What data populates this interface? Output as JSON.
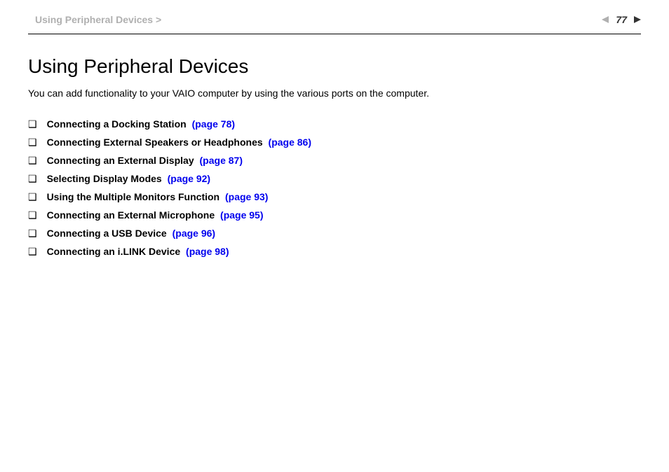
{
  "header": {
    "breadcrumb": "Using Peripheral Devices >",
    "page_number": "77"
  },
  "content": {
    "title": "Using Peripheral Devices",
    "intro": "You can add functionality to your VAIO computer by using the various ports on the computer.",
    "toc": [
      {
        "label": "Connecting a Docking Station",
        "page": "(page 78)"
      },
      {
        "label": "Connecting External Speakers or Headphones",
        "page": "(page 86)"
      },
      {
        "label": "Connecting an External Display",
        "page": "(page 87)"
      },
      {
        "label": "Selecting Display Modes",
        "page": "(page 92)"
      },
      {
        "label": "Using the Multiple Monitors Function",
        "page": "(page 93)"
      },
      {
        "label": "Connecting an External Microphone",
        "page": "(page 95)"
      },
      {
        "label": "Connecting a USB Device",
        "page": "(page 96)"
      },
      {
        "label": "Connecting an i.LINK Device",
        "page": "(page 98)"
      }
    ]
  }
}
